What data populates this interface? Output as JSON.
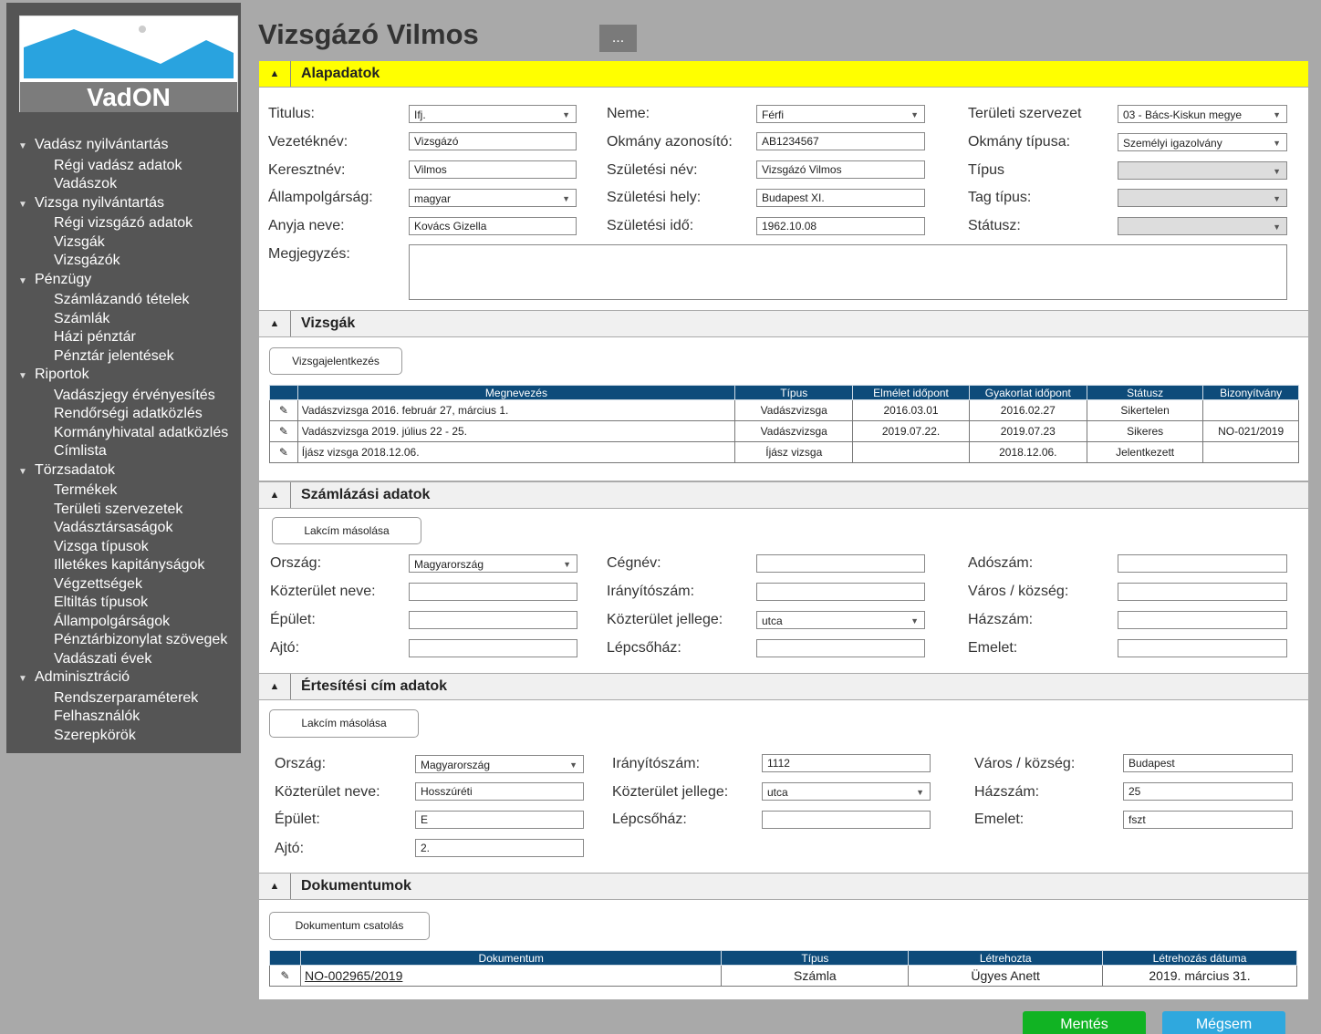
{
  "app": {
    "name": "VadON"
  },
  "sidebar": {
    "groups": [
      {
        "label": "Vadász nyilvántartás",
        "items": [
          "Régi vadász adatok",
          "Vadászok"
        ]
      },
      {
        "label": "Vizsga nyilvántartás",
        "items": [
          "Régi vizsgázó adatok",
          "Vizsgák",
          "Vizsgázók"
        ]
      },
      {
        "label": "Pénzügy",
        "items": [
          "Számlázandó tételek",
          "Számlák",
          "Házi pénztár",
          "Pénztár jelentések"
        ]
      },
      {
        "label": "Riportok",
        "items": [
          "Vadászjegy érvényesítés",
          "Rendőrségi adatközlés",
          "Kormányhivatal adatközlés",
          "Címlista"
        ]
      },
      {
        "label": "Törzsadatok",
        "items": [
          "Termékek",
          "Területi szervezetek",
          "Vadásztársaságok",
          "Vizsga típusok",
          "Illetékes kapitányságok",
          "Végzettségek",
          "Eltiltás típusok",
          "Állampolgárságok",
          "Pénztárbizonylat szövegek",
          "Vadászati évek"
        ]
      },
      {
        "label": "Adminisztráció",
        "items": [
          "Rendszerparaméterek",
          "Felhasználók",
          "Szerepkörök"
        ]
      }
    ]
  },
  "page": {
    "title": "Vizsgázó Vilmos",
    "more_label": "..."
  },
  "alap": {
    "header": "Alapadatok",
    "titulus_label": "Titulus:",
    "titulus": "Ifj.",
    "vezeteknev_label": "Vezetéknév:",
    "vezeteknev": "Vizsgázó",
    "keresztnev_label": "Keresztnév:",
    "keresztnev": "Vilmos",
    "allampolgarsag_label": "Állampolgárság:",
    "allampolgarsag": "magyar",
    "anyja_label": "Anyja neve:",
    "anyja": "Kovács Gizella",
    "megjegyzes_label": "Megjegyzés:",
    "megjegyzes": "",
    "neme_label": "Neme:",
    "neme": "Férfi",
    "okmany_az_label": "Okmány azonosító:",
    "okmany_az": "AB1234567",
    "szul_nev_label": "Születési név:",
    "szul_nev": "Vizsgázó Vilmos",
    "szul_hely_label": "Születési hely:",
    "szul_hely": "Budapest XI.",
    "szul_ido_label": "Születési idő:",
    "szul_ido": "1962.10.08",
    "ter_szerv_label": "Területi szervezet",
    "ter_szerv": "03 - Bács-Kiskun megye",
    "okmany_tip_label": "Okmány típusa:",
    "okmany_tip": "Személyi igazolvány",
    "tipus_label": "Típus",
    "tipus": "",
    "tag_tipus_label": "Tag típus:",
    "tag_tipus": "",
    "statusz_label": "Státusz:",
    "statusz": ""
  },
  "vizsgak": {
    "header": "Vizsgák",
    "button": "Vizsgajelentkezés",
    "columns": [
      "Megnevezés",
      "Típus",
      "Elmélet időpont",
      "Gyakorlat időpont",
      "Státusz",
      "Bizonyítvány"
    ],
    "rows": [
      [
        "Vadászvizsga 2016. február 27, március 1.",
        "Vadászvizsga",
        "2016.03.01",
        "2016.02.27",
        "Sikertelen",
        ""
      ],
      [
        "Vadászvizsga 2019. július 22 - 25.",
        "Vadászvizsga",
        "2019.07.22.",
        "2019.07.23",
        "Sikeres",
        "NO-021/2019"
      ],
      [
        "Íjász vizsga 2018.12.06.",
        "Íjász vizsga",
        "",
        "2018.12.06.",
        "Jelentkezett",
        ""
      ]
    ]
  },
  "szamla": {
    "header": "Számlázási adatok",
    "button": "Lakcím másolása",
    "orszag_label": "Ország:",
    "orszag": "Magyarország",
    "kozt_nev_label": "Közterület neve:",
    "kozt_nev": "",
    "epulet_label": "Épület:",
    "epulet": "",
    "ajto_label": "Ajtó:",
    "ajto": "",
    "cegnev_label": "Cégnév:",
    "cegnev": "",
    "irsz_label": "Irányítószám:",
    "irsz": "",
    "kozt_jell_label": "Közterület jellege:",
    "kozt_jell": "utca",
    "lepcso_label": "Lépcsőház:",
    "lepcso": "",
    "adoszam_label": "Adószám:",
    "adoszam": "",
    "varos_label": "Város / község:",
    "varos": "",
    "hazszam_label": "Házszám:",
    "hazszam": "",
    "emelet_label": "Emelet:",
    "emelet": ""
  },
  "ertesitesi": {
    "header": "Értesítési cím adatok",
    "button": "Lakcím másolása",
    "orszag_label": "Ország:",
    "orszag": "Magyarország",
    "kozt_nev_label": "Közterület neve:",
    "kozt_nev": "Hosszúréti",
    "epulet_label": "Épület:",
    "epulet": "E",
    "ajto_label": "Ajtó:",
    "ajto": "2.",
    "irsz_label": "Irányítószám:",
    "irsz": "1112",
    "kozt_jell_label": "Közterület jellege:",
    "kozt_jell": "utca",
    "lepcso_label": "Lépcsőház:",
    "lepcso": "",
    "varos_label": "Város / község:",
    "varos": "Budapest",
    "hazszam_label": "Házszám:",
    "hazszam": "25",
    "emelet_label": "Emelet:",
    "emelet": "fszt"
  },
  "dokumentumok": {
    "header": "Dokumentumok",
    "button": "Dokumentum csatolás",
    "columns": [
      "Dokumentum",
      "Típus",
      "Létrehozta",
      "Létrehozás dátuma"
    ],
    "rows": [
      [
        "NO-002965/2019",
        "Számla",
        "Ügyes Anett",
        "2019. március 31."
      ]
    ]
  },
  "footer": {
    "save": "Mentés",
    "cancel": "Mégsem"
  }
}
